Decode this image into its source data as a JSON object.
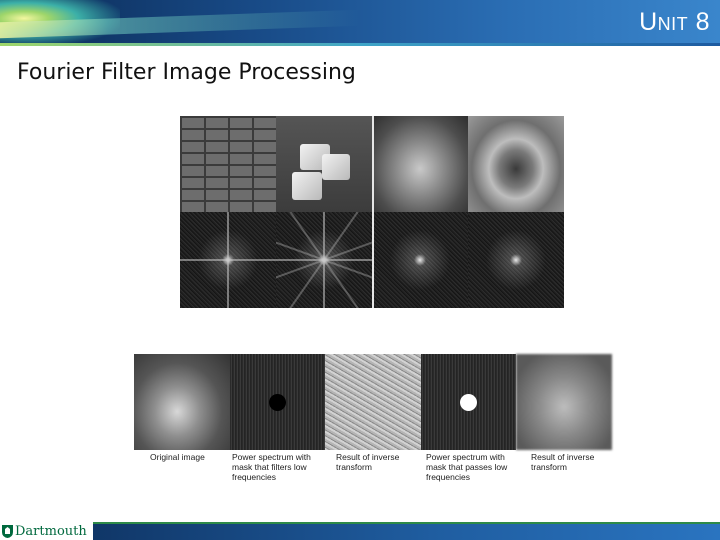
{
  "header": {
    "unit_title": "Unit 8"
  },
  "slide": {
    "title": "Fourier Filter Image Processing"
  },
  "captions": {
    "original": "Original image",
    "mask_low": "Power spectrum with\nmask that filters low\nfrequencies",
    "result1": "Result of inverse\ntransform",
    "mask_pass": "Power spectrum with\nmask that passes low\nfrequencies",
    "result2": "Result of inverse\ntransform"
  },
  "footer": {
    "logo_text": "Dartmouth"
  },
  "colors": {
    "banner": "#184a86",
    "footer": "#1f5da0",
    "logo_green": "#00693e"
  }
}
